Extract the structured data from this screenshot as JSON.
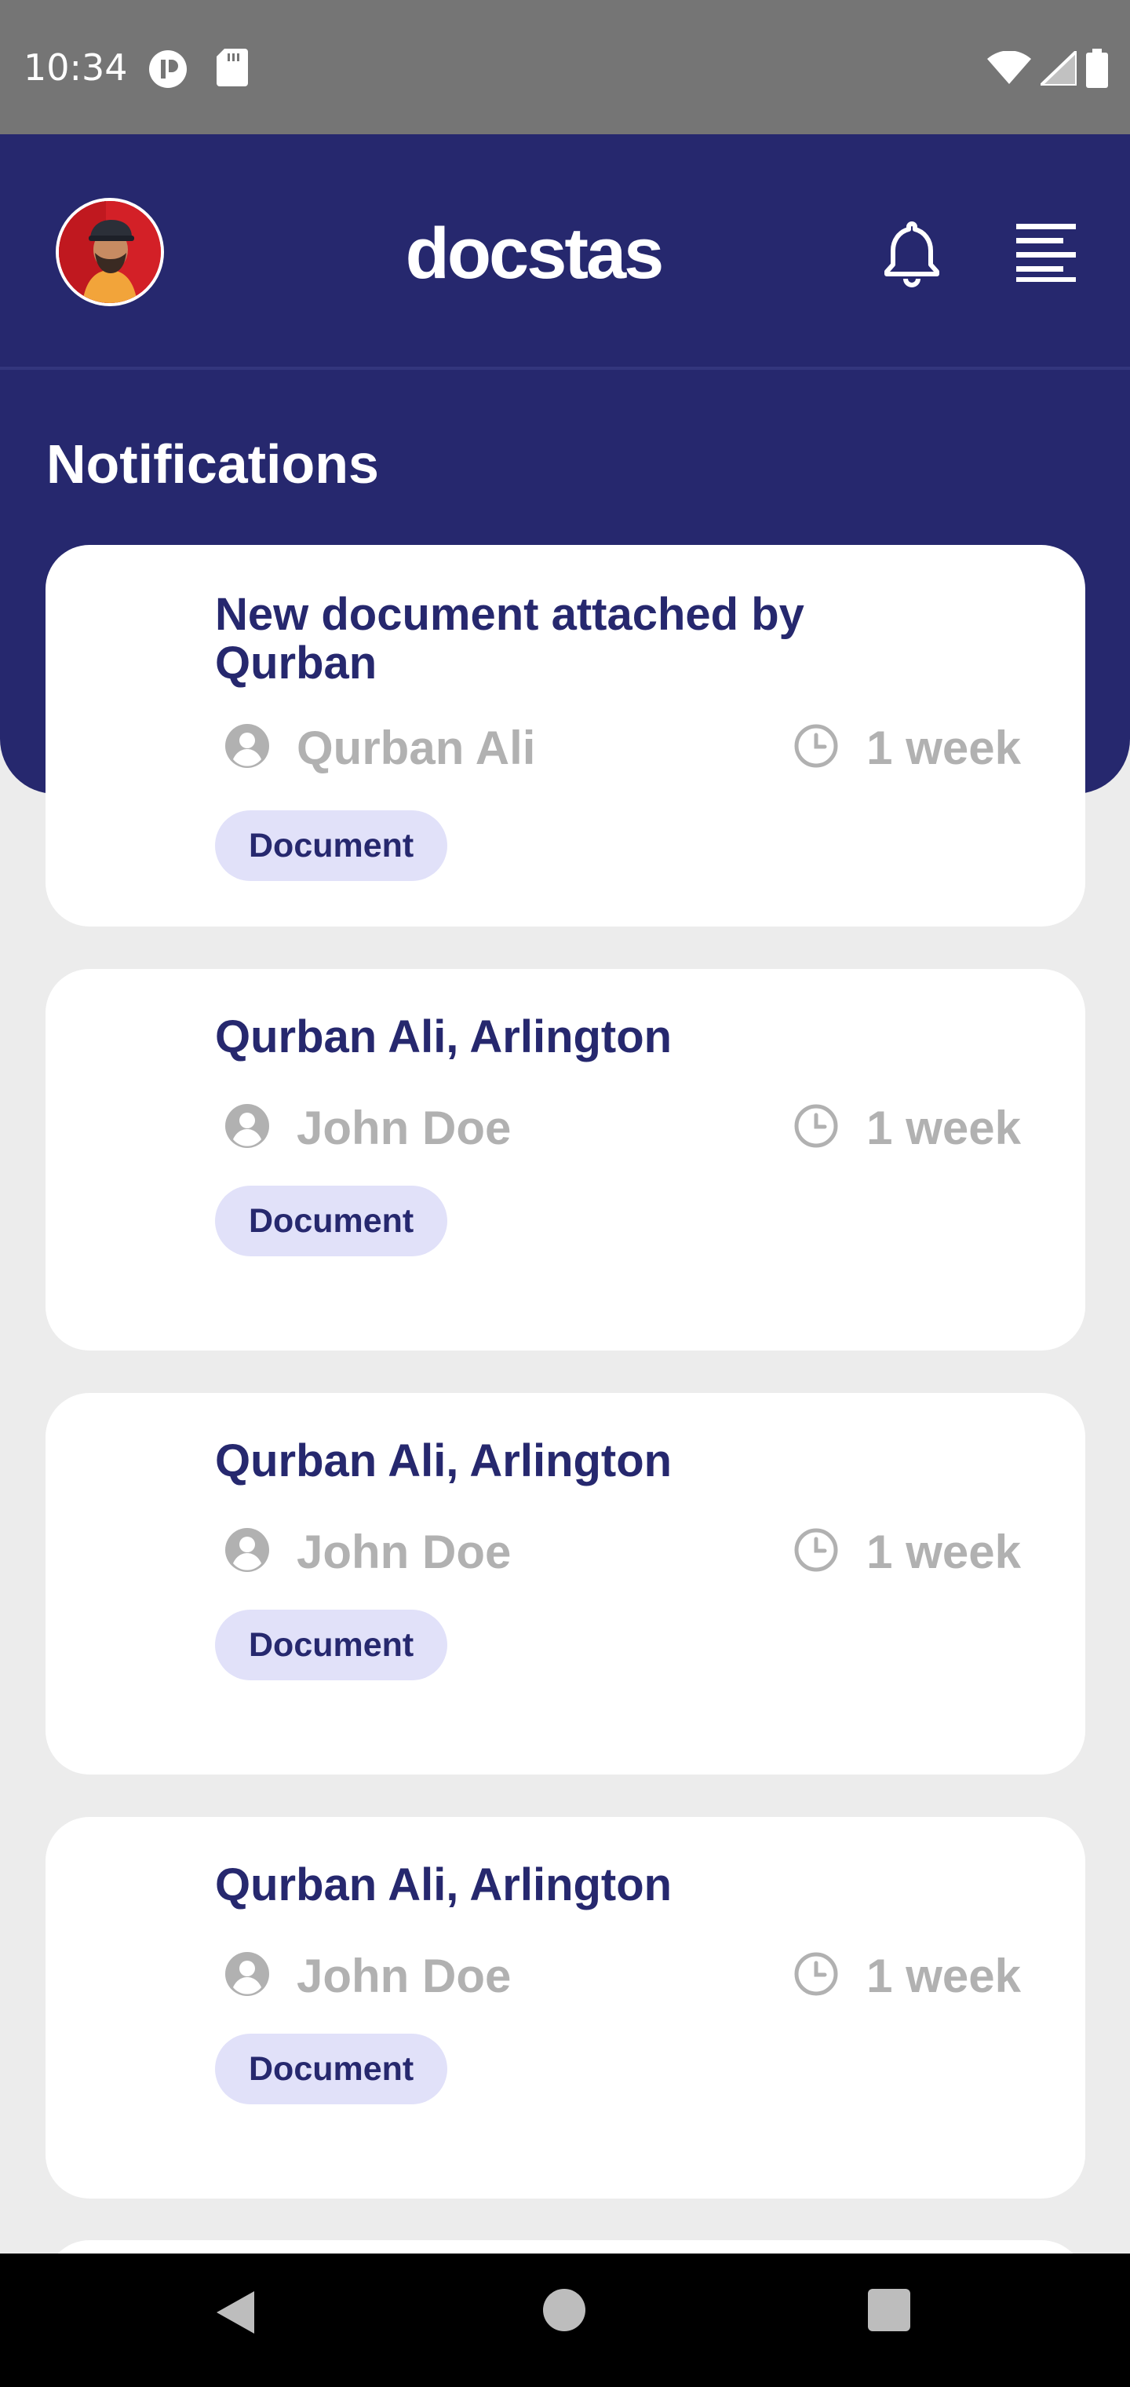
{
  "status_bar": {
    "time": "10:34",
    "left_icons": [
      "media-app-icon",
      "sd-card-icon"
    ],
    "right_icons": [
      "wifi-icon",
      "cell-signal-icon",
      "battery-icon"
    ]
  },
  "header": {
    "logo": "docstas",
    "page_title": "Notifications",
    "colors": {
      "primary": "#26286e",
      "tag_bg": "#e1e1f9",
      "muted": "#b1b1b1"
    }
  },
  "notifications": [
    {
      "title": "New document attached by Qurban",
      "user": "Qurban Ali",
      "time": "1 week",
      "tag": "Document"
    },
    {
      "title": "Qurban Ali, Arlington",
      "user": "John Doe",
      "time": "1 week",
      "tag": "Document"
    },
    {
      "title": "Qurban Ali, Arlington",
      "user": "John Doe",
      "time": "1 week",
      "tag": "Document"
    },
    {
      "title": "Qurban Ali, Arlington",
      "user": "John Doe",
      "time": "1 week",
      "tag": "Document"
    }
  ],
  "nav_bar": {
    "buttons": [
      "back",
      "home",
      "recents"
    ]
  }
}
